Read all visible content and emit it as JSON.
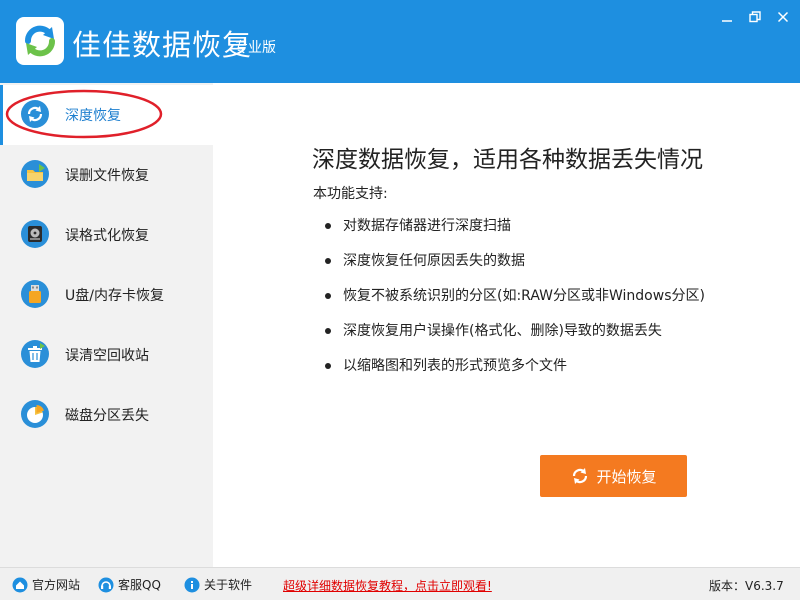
{
  "window": {
    "app_name": "佳佳数据恢复",
    "edition": "专业版"
  },
  "sidebar": {
    "items": [
      {
        "label": "深度恢复",
        "icon": "refresh-icon",
        "active": true
      },
      {
        "label": "误删文件恢复",
        "icon": "folder-icon",
        "active": false
      },
      {
        "label": "误格式化恢复",
        "icon": "disk-icon",
        "active": false
      },
      {
        "label": "U盘/内存卡恢复",
        "icon": "usb-drive-icon",
        "active": false
      },
      {
        "label": "误清空回收站",
        "icon": "recycle-bin-icon",
        "active": false
      },
      {
        "label": "磁盘分区丢失",
        "icon": "pie-chart-icon",
        "active": false
      }
    ]
  },
  "main": {
    "title": "深度数据恢复，适用各种数据丢失情况",
    "support_label": "本功能支持:",
    "features": [
      "对数据存储器进行深度扫描",
      "深度恢复任何原因丢失的数据",
      "恢复不被系统识别的分区(如:RAW分区或非Windows分区)",
      "深度恢复用户误操作(格式化、删除)导致的数据丢失",
      "以缩略图和列表的形式预览多个文件"
    ],
    "start_button": "开始恢复"
  },
  "footer": {
    "official_site": "官方网站",
    "service_qq": "客服QQ",
    "about": "关于软件",
    "promo": "超级详细数据恢复教程，点击立即观看!",
    "version": "版本：V6.3.7"
  },
  "colors": {
    "titlebar": "#1e8fe0",
    "accent_orange": "#f47a20",
    "promo_red": "#e00000",
    "annotation_red": "#e0202a"
  }
}
